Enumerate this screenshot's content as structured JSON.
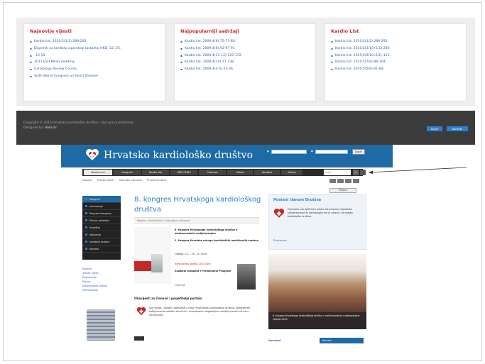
{
  "boxes": [
    {
      "title": "Najnovije vijesti",
      "items": [
        "Kardio list. 2010;5(1/2):289-292.",
        "Dopisnik sa kardiolo ciparskog sastanka HKD. 22.-25.",
        "10-10",
        "2011 ESH Milan meeting",
        "Cardiology Review Course",
        "Sixth World Congress on Heart Disease"
      ]
    },
    {
      "title": "Najpopularniji sadržaji",
      "items": [
        "Kardio list. 2009;4(6):75-77-80.",
        "Kardio list. 2009;4(6):92-97-91.",
        "Kardio list. 2009;4(11-12):129-172.",
        "Kardio list. 2009;4(10):77-138.",
        "Kardio list. 2009;4(4-5):23-36."
      ]
    },
    {
      "title": "Kardio List",
      "items": [
        "Kardio list. 2010;5(1/2):289-292.",
        "Kardio list. 2010;5(3/10):133-266.",
        "Kardio list. 2010;5(9/10):101-121.",
        "Kardio list. 2010;5(7/8):89-104.",
        "Kardio list. 2010;5(5/6):61-84."
      ]
    }
  ],
  "footer": {
    "copyright": "Copyright © 2010 Hrvatsko kardiološko društvo – Sva prava pridržana.",
    "designed_by": "Designed by:",
    "designer": "Helix.hr",
    "btn1": "Login",
    "btn2": "Kontakt"
  },
  "inner": {
    "site_title": "Hrvatsko kardiološko društvo",
    "login_btn": "Login",
    "nav": [
      "Naslovnica",
      "Kongresi",
      "Kardio list",
      "HKD CHDS",
      "Članstvo",
      "Linkovi",
      "Kontakt",
      "Arhiva"
    ],
    "nav_search": "traži...",
    "nav_go": "»",
    "subnav": [
      "Novosti",
      "Tekuće vijesti",
      "Kalendar zbivanja",
      "Pravila Društva"
    ],
    "right_pill": "Prijava",
    "left_menu": [
      "Kongresi",
      "Informacije",
      "Program kongresa",
      "Prijava sažetaka",
      "Smještaj",
      "Kotizacija",
      "Izložbeni prostor",
      "Kontakt"
    ],
    "left_links": [
      "Novosti",
      "Tekuće vijesti",
      "Registracija",
      "Prijava",
      "Zaboravljena lozinka",
      "Pretraživanje"
    ],
    "article_title": "8. kongres Hrvatskoga kardiološkog društva",
    "meta": "Napisao: Administrator | Objavljeno u Kongresi",
    "p1": "8. Kongres Hrvatskoga kardiološkog društva s međunarodnim sudjelovanjem",
    "p2": "1. Kongres Hrvatske udruge kardioloških medicinskih sestara",
    "p3": "Opatija, 22. – 25. 11. 2010.",
    "p4_link": "www.kardio-opatija-2010.com",
    "p5": "Službeni prospekt i Preliminarni Program",
    "p6": "Opširnije",
    "section_head": "Obavijesti za članove i posjetitelje portala",
    "section_txt": "Sve vijesti, novosti i obavijesti o radu Hrvatskoga kardiološkog društva, kongresima, tečajevima te ostalim stručnim i znanstvenim događajima možete pronaći na ovim stranicama.",
    "rbox_title": "Postani članom Društva",
    "rbox_txt": "Pozivamo sve liječnike i ostale zdravstvene djelatnike zainteresirane za kardiologiju da se učlane u Hrvatsko kardiološko društvo.",
    "rbox_link": "Pristupnica",
    "photo_caption": "8. Kongres Hrvatskoga kardiološkog društva s međunarodnim sudjelovanjem, Opatija 2010.",
    "rbot_lbl": "Sponzori",
    "rbot_btn": "Kontakt"
  },
  "colors": {
    "header_blue": "#1d6aa5",
    "title_red": "#c62828",
    "link_blue": "#2a5db0",
    "footer_dark": "#3c3c3c"
  }
}
